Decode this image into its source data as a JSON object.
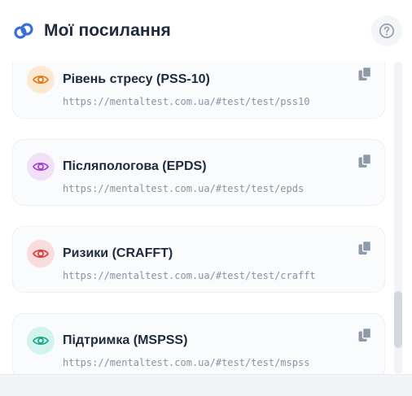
{
  "header": {
    "title": "Мої посилання",
    "logo_icon": "link-icon",
    "help_icon": "question-circle-icon",
    "brand_color": "#3b6fd8"
  },
  "links": [
    {
      "title": "Рівень стресу (PSS-10)",
      "url": "https://mentaltest.com.ua/#test/test/pss10",
      "icon": "eye-icon",
      "accent": "#e07a1c",
      "accent_bg": "#fde9d2"
    },
    {
      "title": "Післяпологова (EPDS)",
      "url": "https://mentaltest.com.ua/#test/test/epds",
      "icon": "eye-icon",
      "accent": "#a445cc",
      "accent_bg": "#f2e0f8"
    },
    {
      "title": "Ризики (CRAFFT)",
      "url": "https://mentaltest.com.ua/#test/test/crafft",
      "icon": "eye-icon",
      "accent": "#d8403c",
      "accent_bg": "#fbdcdc"
    },
    {
      "title": "Підтримка (MSPSS)",
      "url": "https://mentaltest.com.ua/#test/test/mspss",
      "icon": "eye-icon",
      "accent": "#19a98a",
      "accent_bg": "#d3f4ec"
    }
  ],
  "copy_icon": "copy-icon"
}
